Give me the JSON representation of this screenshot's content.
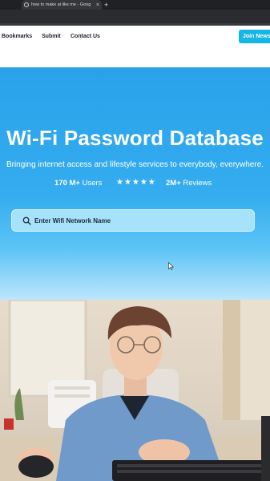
{
  "browser": {
    "tab_title": "how to make ai like me - Goog",
    "close_glyph": "×",
    "new_tab_glyph": "+"
  },
  "nav": {
    "links": [
      "Bookmarks",
      "Submit",
      "Contact Us"
    ],
    "cta_label": "Join News"
  },
  "hero": {
    "title": "Wi-Fi Password Database",
    "subtitle": "Bringing internet access and lifestyle services to everybody, everywhere.",
    "stats": {
      "users_value": "170 M+",
      "users_label": "Users",
      "stars": "★★★★★",
      "reviews_value": "2M+",
      "reviews_label": "Reviews"
    },
    "search": {
      "placeholder": "Enter Wifi Network Name",
      "value": ""
    }
  },
  "colors": {
    "brand_blue": "#2aa2ea",
    "cta": "#17b5e6",
    "nav_text": "#1a1f2b"
  },
  "icons": [
    "search-icon",
    "mouse-cursor-icon",
    "close-icon",
    "plus-icon"
  ]
}
